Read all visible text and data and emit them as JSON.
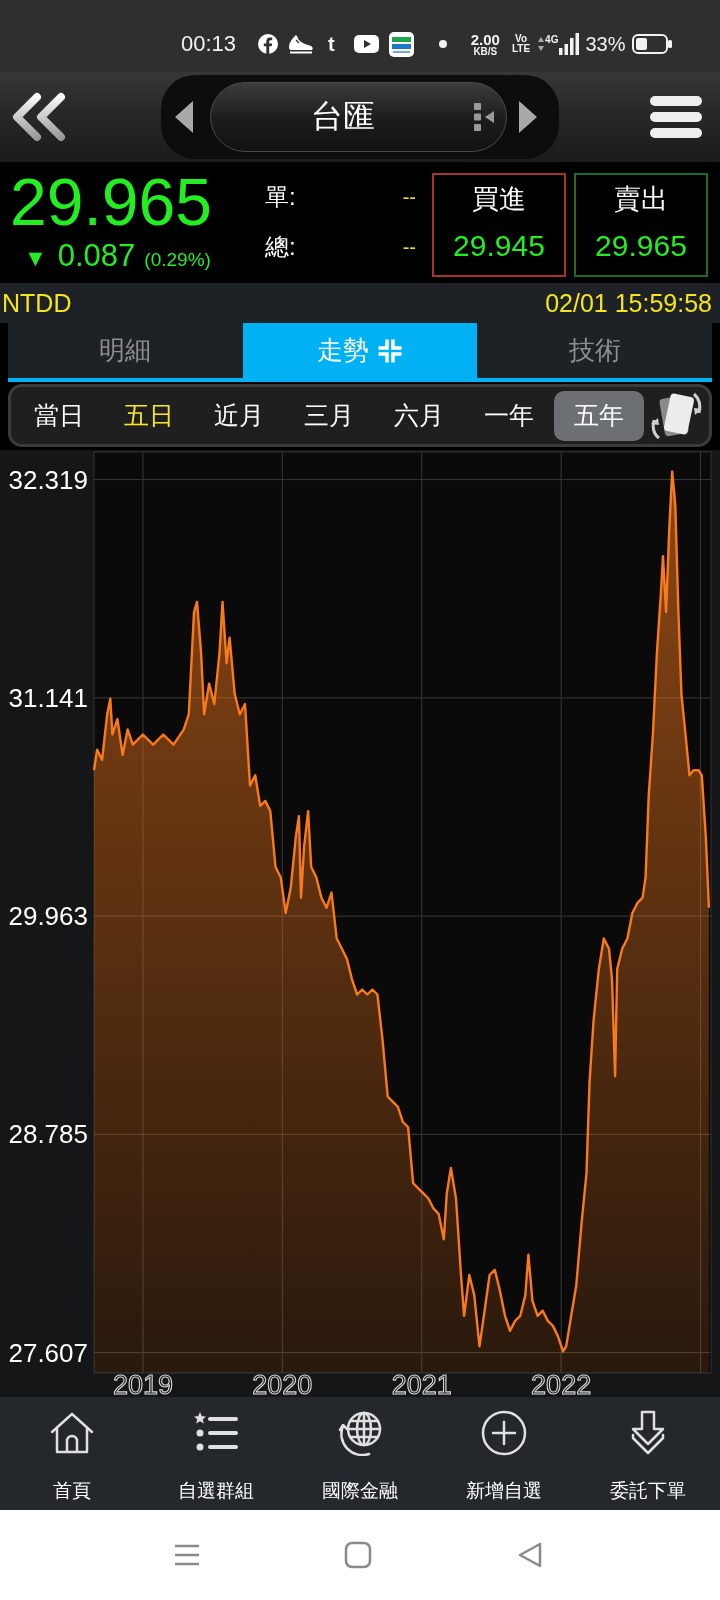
{
  "status_bar": {
    "time": "00:13",
    "app_glyph": "t",
    "speed": "2.00",
    "speed_unit": "KB/S",
    "volte_top": "Vo",
    "volte_bottom": "LTE",
    "network": "4G",
    "battery": "33%"
  },
  "header": {
    "title": "台匯"
  },
  "quote": {
    "price": "29.965",
    "change_arrow": "▼",
    "change": "0.087",
    "change_percent": "(0.29%)",
    "stats": [
      {
        "label": "單:",
        "value": "--"
      },
      {
        "label": "總:",
        "value": "--"
      }
    ],
    "sides": [
      {
        "kind": "buy",
        "label": "買進",
        "value": "29.945"
      },
      {
        "kind": "sell",
        "label": "賣出",
        "value": "29.965"
      }
    ]
  },
  "info_bar": {
    "symbol": "NTDD",
    "timestamp": "02/01 15:59:58"
  },
  "tabs": [
    {
      "label": "明細",
      "selected": false,
      "compress_toggle": false
    },
    {
      "label": "走勢",
      "selected": true,
      "compress_toggle": true
    },
    {
      "label": "技術",
      "selected": false,
      "compress_toggle": false
    }
  ],
  "periods": [
    {
      "label": "當日",
      "selected": false,
      "highlighted": false
    },
    {
      "label": "五日",
      "selected": false,
      "highlighted": true
    },
    {
      "label": "近月",
      "selected": false,
      "highlighted": false
    },
    {
      "label": "三月",
      "selected": false,
      "highlighted": false
    },
    {
      "label": "六月",
      "selected": false,
      "highlighted": false
    },
    {
      "label": "一年",
      "selected": false,
      "highlighted": false
    },
    {
      "label": "五年",
      "selected": true,
      "highlighted": false
    }
  ],
  "chart": {
    "chart_data": {
      "type": "area",
      "grid": true,
      "x": [
        2018.649,
        2018.671,
        2018.707,
        2018.744,
        2018.766,
        2018.781,
        2018.817,
        2018.854,
        2018.89,
        2018.927,
        2019.0,
        2019.073,
        2019.146,
        2019.219,
        2019.293,
        2019.329,
        2019.366,
        2019.388,
        2019.417,
        2019.439,
        2019.475,
        2019.512,
        2019.549,
        2019.571,
        2019.6,
        2019.622,
        2019.658,
        2019.695,
        2019.732,
        2019.768,
        2019.805,
        2019.841,
        2019.878,
        2019.914,
        2019.951,
        2019.988,
        2020.024,
        2020.061,
        2020.097,
        2020.119,
        2020.134,
        2020.156,
        2020.185,
        2020.207,
        2020.244,
        2020.28,
        2020.317,
        2020.353,
        2020.39,
        2020.427,
        2020.463,
        2020.5,
        2020.536,
        2020.573,
        2020.609,
        2020.646,
        2020.682,
        2020.719,
        2020.756,
        2020.792,
        2020.829,
        2020.865,
        2020.902,
        2020.938,
        2020.975,
        2021.012,
        2021.048,
        2021.085,
        2021.121,
        2021.158,
        2021.18,
        2021.209,
        2021.246,
        2021.282,
        2021.304,
        2021.341,
        2021.377,
        2021.414,
        2021.451,
        2021.487,
        2021.524,
        2021.56,
        2021.597,
        2021.633,
        2021.67,
        2021.707,
        2021.743,
        2021.765,
        2021.794,
        2021.831,
        2021.868,
        2021.904,
        2021.941,
        2021.977,
        2022.014,
        2022.036,
        2022.072,
        2022.109,
        2022.146,
        2022.182,
        2022.204,
        2022.233,
        2022.27,
        2022.306,
        2022.343,
        2022.365,
        2022.387,
        2022.402,
        2022.438,
        2022.475,
        2022.511,
        2022.548,
        2022.584,
        2022.606,
        2022.628,
        2022.658,
        2022.687,
        2022.716,
        2022.731,
        2022.753,
        2022.775,
        2022.797,
        2022.819,
        2022.841,
        2022.863,
        2022.892,
        2022.921,
        2022.95,
        2022.987,
        2023.009,
        2023.038,
        2023.06
      ],
      "series": [
        {
          "color": "#f97a1c",
          "values": [
            30.75,
            30.861,
            30.806,
            31.053,
            31.136,
            30.943,
            31.026,
            30.833,
            30.971,
            30.888,
            30.943,
            30.888,
            30.943,
            30.888,
            30.971,
            31.053,
            31.604,
            31.659,
            31.383,
            31.053,
            31.218,
            31.108,
            31.383,
            31.659,
            31.328,
            31.466,
            31.163,
            31.053,
            31.108,
            30.668,
            30.723,
            30.558,
            30.585,
            30.53,
            30.228,
            30.173,
            29.98,
            30.118,
            30.393,
            30.503,
            30.063,
            30.338,
            30.53,
            30.228,
            30.173,
            30.063,
            30.008,
            30.09,
            29.842,
            29.787,
            29.732,
            29.622,
            29.54,
            29.567,
            29.54,
            29.567,
            29.54,
            29.292,
            28.989,
            28.962,
            28.934,
            28.852,
            28.824,
            28.522,
            28.494,
            28.467,
            28.439,
            28.384,
            28.356,
            28.219,
            28.467,
            28.604,
            28.439,
            28.026,
            27.806,
            28.026,
            27.916,
            27.641,
            27.833,
            28.026,
            28.054,
            27.944,
            27.806,
            27.724,
            27.778,
            27.806,
            27.916,
            28.136,
            27.888,
            27.806,
            27.833,
            27.778,
            27.751,
            27.696,
            27.613,
            27.641,
            27.806,
            27.971,
            28.301,
            28.577,
            29.072,
            29.402,
            29.677,
            29.842,
            29.787,
            29.622,
            29.099,
            29.677,
            29.787,
            29.842,
            29.98,
            30.035,
            30.063,
            30.173,
            30.613,
            30.943,
            31.383,
            31.714,
            31.906,
            31.604,
            32.044,
            32.363,
            32.181,
            31.604,
            31.163,
            30.943,
            30.723,
            30.75,
            30.75,
            30.723,
            30.393,
            30.008
          ]
        }
      ],
      "xlim": [
        2018.649,
        2023.075
      ],
      "ylim": [
        27.497,
        32.468
      ],
      "xticks": [
        2019,
        2020,
        2021,
        2022
      ],
      "yticks": [
        27.607,
        28.785,
        29.963,
        31.141,
        32.319
      ]
    }
  },
  "bottom_nav": [
    {
      "kind": "home",
      "label": "首頁"
    },
    {
      "kind": "watchlist",
      "label": "自選群組"
    },
    {
      "kind": "global",
      "label": "國際金融"
    },
    {
      "kind": "add",
      "label": "新增自選"
    },
    {
      "kind": "order",
      "label": "委託下單"
    }
  ]
}
